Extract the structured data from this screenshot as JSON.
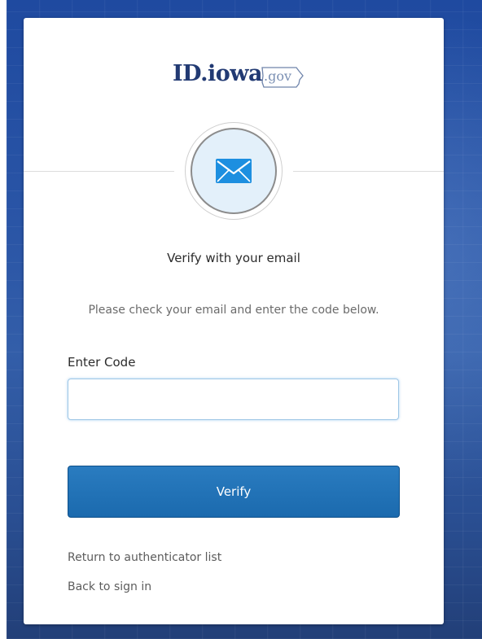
{
  "logo": {
    "main": "ID.iowa",
    "tld": ".gov"
  },
  "icon": {
    "name": "envelope-icon",
    "color": "#1d8fe0"
  },
  "header": {
    "title": "Verify with your email",
    "subtitle": "Please check your email and enter the code below."
  },
  "form": {
    "code_label": "Enter Code",
    "code_value": "",
    "verify_label": "Verify"
  },
  "links": {
    "return": "Return to authenticator list",
    "back": "Back to sign in"
  },
  "colors": {
    "primary_button": "#1b6aae",
    "brand_navy": "#223a73",
    "background_blue": "#2a55a6"
  }
}
